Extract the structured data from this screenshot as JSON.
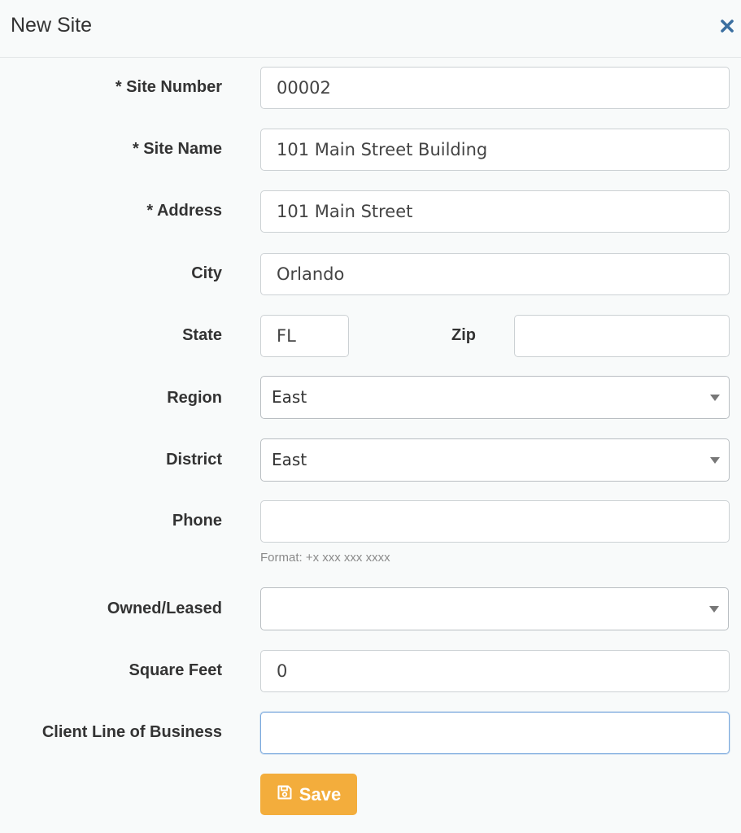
{
  "dialog": {
    "title": "New Site",
    "close_icon": "close-icon"
  },
  "form": {
    "site_number": {
      "label": "* Site Number",
      "value": "00002"
    },
    "site_name": {
      "label": "* Site Name",
      "value": "101 Main Street Building"
    },
    "address": {
      "label": "* Address",
      "value": "101 Main Street"
    },
    "city": {
      "label": "City",
      "value": "Orlando"
    },
    "state": {
      "label": "State",
      "value": "FL"
    },
    "zip": {
      "label": "Zip",
      "value": ""
    },
    "region": {
      "label": "Region",
      "value": "East"
    },
    "district": {
      "label": "District",
      "value": "East"
    },
    "phone": {
      "label": "Phone",
      "value": "",
      "hint": "Format: +x xxx xxx xxxx"
    },
    "owned_leased": {
      "label": "Owned/Leased",
      "value": ""
    },
    "square_feet": {
      "label": "Square Feet",
      "value": "0"
    },
    "client_line_of_business": {
      "label": "Client Line of Business",
      "value": ""
    }
  },
  "actions": {
    "save_label": "Save",
    "save_icon": "floppy-disk-icon",
    "save_color": "#f3ad3c"
  },
  "colors": {
    "close_icon": "#3b6fa0",
    "focus_border": "#79a8dd"
  }
}
